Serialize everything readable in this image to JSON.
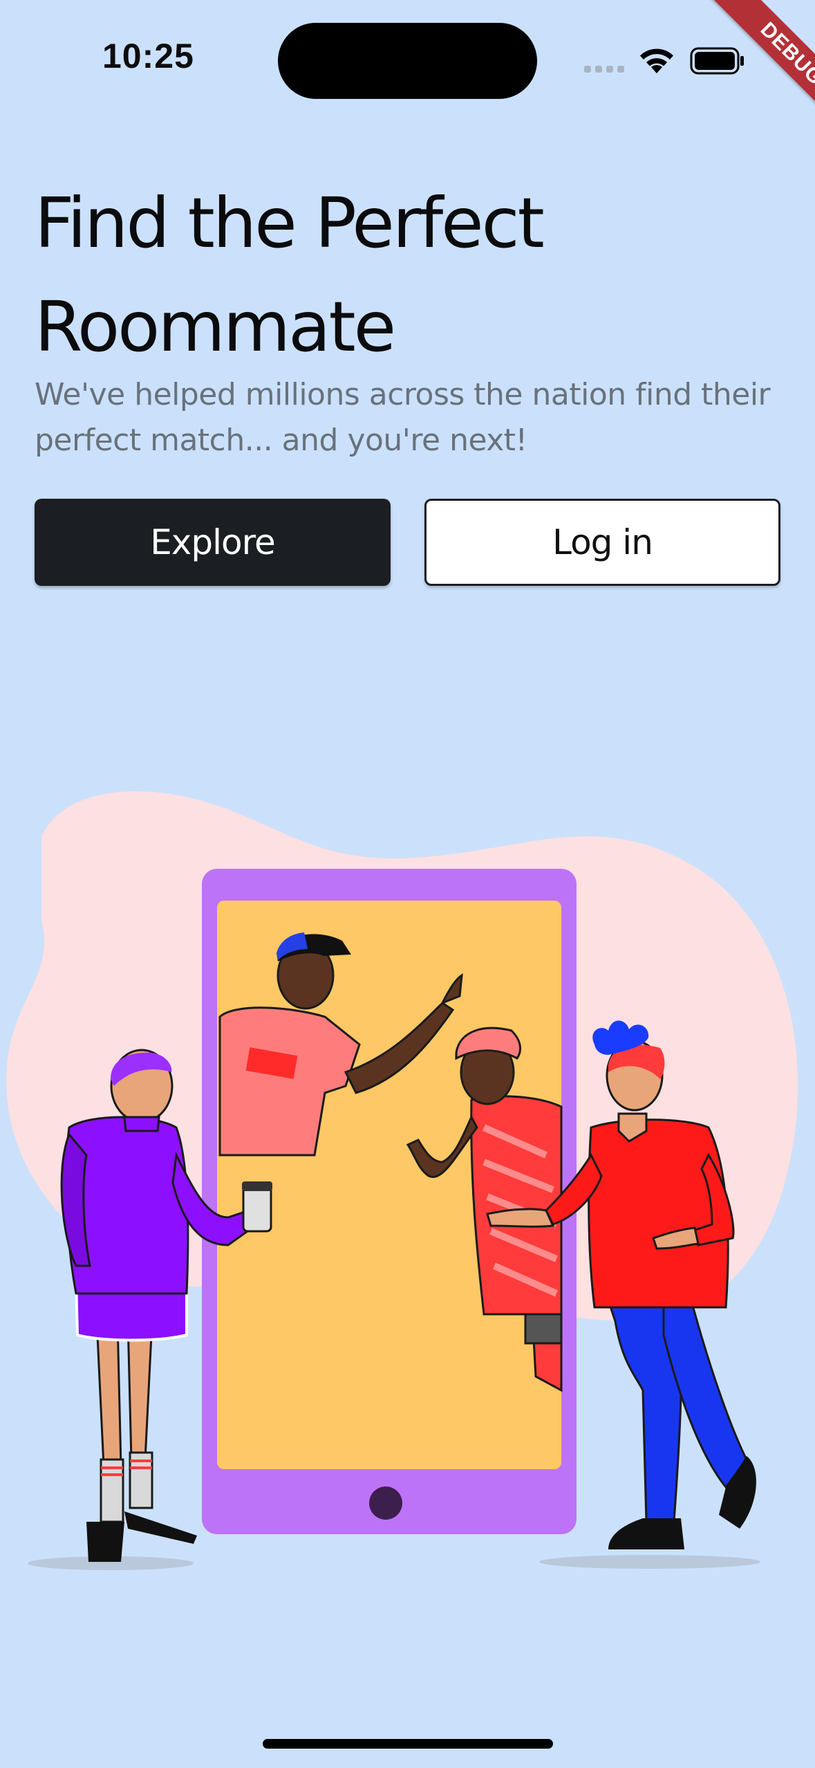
{
  "status_bar": {
    "time": "10:25",
    "signal_icon": "cellular-signal-icon",
    "wifi_icon": "wifi-icon",
    "battery_icon": "battery-icon"
  },
  "debug_banner": "DEBUG",
  "hero": {
    "title": "Find the Perfect Roommate",
    "subtitle": "We've helped millions across the nation find their perfect match... and you're next!"
  },
  "actions": {
    "explore_label": "Explore",
    "login_label": "Log in"
  },
  "illustration": {
    "icon": "roommates-phone-illustration"
  },
  "colors": {
    "background": "#cbe1fb",
    "primary_button": "#1b1e22",
    "subtitle_text": "#68727c",
    "phone_frame": "#bd73f7",
    "phone_screen": "#fdc865",
    "blob": "#fde0e2"
  }
}
